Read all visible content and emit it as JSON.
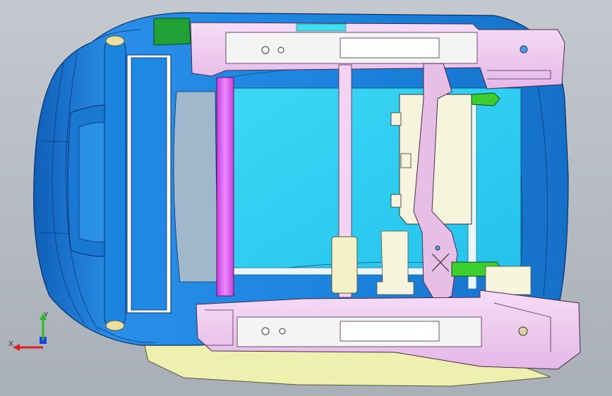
{
  "viewport": {
    "background_top": "#c4c9d0",
    "background_bottom": "#a9afb7"
  },
  "model": {
    "parts": [
      {
        "name": "seat-shell",
        "color": "#1f8fe6"
      },
      {
        "name": "seat-cushion",
        "color": "#34d4f2"
      },
      {
        "name": "rail-assembly",
        "color": "#f2cdf0"
      },
      {
        "name": "armrest-bar",
        "color": "#e070f0"
      },
      {
        "name": "adjuster-bracket",
        "color": "#3ccd2e"
      },
      {
        "name": "control-box",
        "color": "#f6f4dc"
      },
      {
        "name": "trim-panel",
        "color": "#eef0b0"
      },
      {
        "name": "mount-block",
        "color": "#22a236"
      }
    ]
  },
  "triad": {
    "x_label": "X",
    "y_label": "Y",
    "x_color": "#e02020",
    "y_color": "#20c020",
    "z_color": "#2040e0"
  }
}
